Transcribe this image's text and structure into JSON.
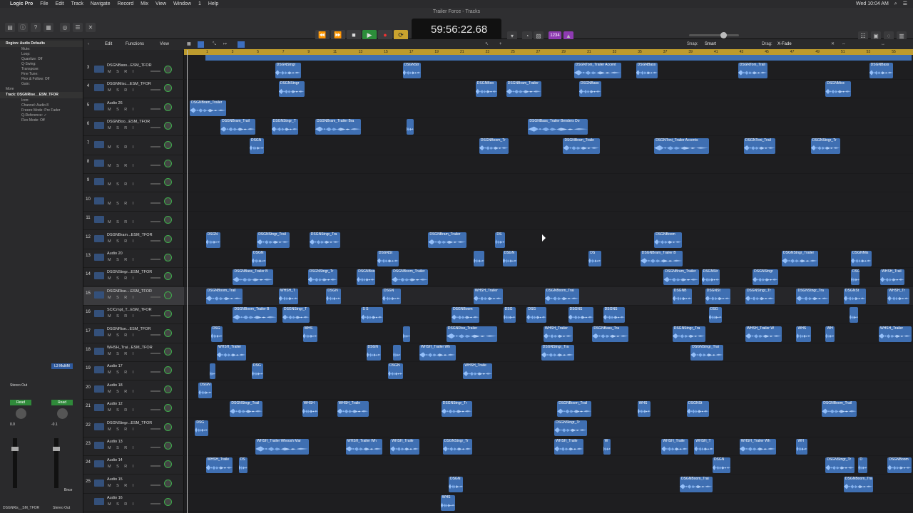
{
  "menubar": {
    "app": "Logic Pro",
    "items": [
      "File",
      "Edit",
      "Track",
      "Navigate",
      "Record",
      "Mix",
      "View",
      "Window",
      "1",
      "Help"
    ],
    "clock": "Wed 10:04 AM"
  },
  "window": {
    "title": "Trailer Force - Tracks"
  },
  "transport": {
    "time": "59:56:22.68",
    "rewind": "⏪",
    "forward": "⏩",
    "stop": "■",
    "play": "▶",
    "record": "●",
    "cycle": "⟳",
    "count_in": "1234"
  },
  "edit_bar": {
    "edit": "Edit",
    "functions": "Functions",
    "view": "View",
    "snap_label": "Snap:",
    "snap_value": "Smart",
    "drag_label": "Drag:",
    "drag_value": "X-Fade"
  },
  "inspector": {
    "region_header": "Region: Audio Defaults",
    "track_header": "Track: DSGNRise__ESM_TFOR",
    "params": [
      "Mute:",
      "Loop:",
      "Quantize: Off",
      "Q-Swing:",
      "Transpose:",
      "Fine Tune:",
      "Flex & Follow: Off",
      "Gain:"
    ],
    "track_params": [
      "Icon:",
      "Channel: Audio 8",
      "Freeze Mode: Pre Fader",
      "Q-Reference: ✓",
      "Flex Mode: Off"
    ],
    "more": "More",
    "stereo_out": "Stereo Out",
    "read1": "Read",
    "read2": "Read",
    "vol1": "0.0",
    "vol2": "-0.1",
    "multi": "L3 MultiM",
    "bottom_left": "DSGNRis__SM_TFOR",
    "bottom_right": "Stereo Out",
    "bnce": "Bnce"
  },
  "ruler": {
    "ticks": [
      "1",
      "3",
      "5",
      "7",
      "9",
      "11",
      "13",
      "15",
      "17",
      "19",
      "21",
      "23",
      "25",
      "27",
      "29",
      "31",
      "33",
      "35",
      "37",
      "39",
      "41",
      "43",
      "45",
      "47",
      "49",
      "51",
      "53",
      "55"
    ]
  },
  "tracks": [
    {
      "num": "3",
      "name": "DSGNBass...ESM_TFOR"
    },
    {
      "num": "4",
      "name": "DSGNMisc...ESM_TFOR"
    },
    {
      "num": "5",
      "name": "Audio 26"
    },
    {
      "num": "6",
      "name": "DSGNBoo...ESM_TFOR"
    },
    {
      "num": "7",
      "name": ""
    },
    {
      "num": "8",
      "name": ""
    },
    {
      "num": "9",
      "name": ""
    },
    {
      "num": "10",
      "name": ""
    },
    {
      "num": "11",
      "name": ""
    },
    {
      "num": "12",
      "name": "DSGNBram...ESM_TFOR"
    },
    {
      "num": "13",
      "name": "Audio 20"
    },
    {
      "num": "14",
      "name": "DSGNStngr...ESM_TFOR"
    },
    {
      "num": "15",
      "name": "DSGNRise....ESM_TFOR"
    },
    {
      "num": "16",
      "name": "SCICmpt_T...ESM_TFOR"
    },
    {
      "num": "17",
      "name": "DSGNRise...ESM_TFOR"
    },
    {
      "num": "18",
      "name": "WHSH_Trai...ESM_TFOR"
    },
    {
      "num": "19",
      "name": "Audio 17"
    },
    {
      "num": "20",
      "name": "Audio 18"
    },
    {
      "num": "21",
      "name": "Audio 12"
    },
    {
      "num": "22",
      "name": "DSGNStngr...ESM_TFOR"
    },
    {
      "num": "23",
      "name": "Audio 13"
    },
    {
      "num": "24",
      "name": "Audio 14"
    },
    {
      "num": "25",
      "name": "Audio 15"
    },
    {
      "num": "",
      "name": "Audio 16"
    }
  ],
  "ms_label": "M S R I",
  "regions": [
    {
      "lane": 0,
      "start": 0.125,
      "len": 0.035,
      "label": "DSGNStngr"
    },
    {
      "lane": 0,
      "start": 0.3,
      "len": 0.025,
      "label": "DSGNStr"
    },
    {
      "lane": 0,
      "start": 0.535,
      "len": 0.065,
      "label": "DSGNToni_Trailer Accent"
    },
    {
      "lane": 0,
      "start": 0.62,
      "len": 0.03,
      "label": "DSGNBass"
    },
    {
      "lane": 0,
      "start": 0.76,
      "len": 0.04,
      "label": "DSGNToni_Trail"
    },
    {
      "lane": 0,
      "start": 0.94,
      "len": 0.033,
      "label": "DSGNBass"
    },
    {
      "lane": 1,
      "start": 0.13,
      "len": 0.035,
      "label": "DSGNStngr"
    },
    {
      "lane": 1,
      "start": 0.4,
      "len": 0.03,
      "label": "DSGNBoo"
    },
    {
      "lane": 1,
      "start": 0.442,
      "len": 0.048,
      "label": "DSGNBram_Trailer"
    },
    {
      "lane": 1,
      "start": 0.542,
      "len": 0.03,
      "label": "DSGNBass"
    },
    {
      "lane": 1,
      "start": 0.88,
      "len": 0.035,
      "label": "DSGNMisc"
    },
    {
      "lane": 2,
      "start": 0.008,
      "len": 0.05,
      "label": "DSGNBram_Trailer"
    },
    {
      "lane": 3,
      "start": 0.05,
      "len": 0.048,
      "label": "DSGNBram_Trail"
    },
    {
      "lane": 3,
      "start": 0.12,
      "len": 0.037,
      "label": "DSGNStngr_T"
    },
    {
      "lane": 3,
      "start": 0.18,
      "len": 0.063,
      "label": "DSGNBram_Trailer Bra"
    },
    {
      "lane": 3,
      "start": 0.305,
      "len": 0.01,
      "label": ""
    },
    {
      "lane": 3,
      "start": 0.472,
      "len": 0.082,
      "label": "DSGNBass_Trailer Benders Do"
    },
    {
      "lane": 4,
      "start": 0.09,
      "len": 0.02,
      "label": "DSGN"
    },
    {
      "lane": 4,
      "start": 0.405,
      "len": 0.04,
      "label": "DSGNBoom_Tr"
    },
    {
      "lane": 4,
      "start": 0.52,
      "len": 0.05,
      "label": "DSGNBram_Traile"
    },
    {
      "lane": 4,
      "start": 0.645,
      "len": 0.075,
      "label": "DSGNToni_Trailer Accents"
    },
    {
      "lane": 4,
      "start": 0.768,
      "len": 0.043,
      "label": "DSGNToni_Trail"
    },
    {
      "lane": 4,
      "start": 0.86,
      "len": 0.04,
      "label": "DSGNStngr_Tr"
    },
    {
      "lane": 9,
      "start": 0.03,
      "len": 0.02,
      "label": "DSGN"
    },
    {
      "lane": 9,
      "start": 0.1,
      "len": 0.045,
      "label": "DSGNStngr_Trail"
    },
    {
      "lane": 9,
      "start": 0.172,
      "len": 0.042,
      "label": "DSGNStngr_Tra"
    },
    {
      "lane": 9,
      "start": 0.335,
      "len": 0.052,
      "label": "DSGNBram_Trailer"
    },
    {
      "lane": 9,
      "start": 0.427,
      "len": 0.013,
      "label": "DS"
    },
    {
      "lane": 9,
      "start": 0.645,
      "len": 0.038,
      "label": "DSGNBoom"
    },
    {
      "lane": 10,
      "start": 0.093,
      "len": 0.02,
      "label": "DSGN"
    },
    {
      "lane": 10,
      "start": 0.265,
      "len": 0.03,
      "label": "DSGNSt"
    },
    {
      "lane": 10,
      "start": 0.397,
      "len": 0.015,
      "label": ""
    },
    {
      "lane": 10,
      "start": 0.437,
      "len": 0.02,
      "label": "DSGN"
    },
    {
      "lane": 10,
      "start": 0.555,
      "len": 0.017,
      "label": "DS"
    },
    {
      "lane": 10,
      "start": 0.626,
      "len": 0.058,
      "label": "DSGNBram_Trailer B"
    },
    {
      "lane": 10,
      "start": 0.82,
      "len": 0.05,
      "label": "DSGNStngr_Trailer"
    },
    {
      "lane": 10,
      "start": 0.915,
      "len": 0.028,
      "label": "DSGNMis"
    },
    {
      "lane": 11,
      "start": 0.067,
      "len": 0.055,
      "label": "DSGNBass_Trailer B"
    },
    {
      "lane": 11,
      "start": 0.17,
      "len": 0.04,
      "label": "DSGNStngr_Tr"
    },
    {
      "lane": 11,
      "start": 0.237,
      "len": 0.025,
      "label": "DSGNBoo"
    },
    {
      "lane": 11,
      "start": 0.285,
      "len": 0.05,
      "label": "DSGNBoom_Trailer"
    },
    {
      "lane": 11,
      "start": 0.658,
      "len": 0.048,
      "label": "DSGNBram_Trailer"
    },
    {
      "lane": 11,
      "start": 0.71,
      "len": 0.025,
      "label": "DSGNStr"
    },
    {
      "lane": 11,
      "start": 0.78,
      "len": 0.035,
      "label": "DSGNStngr"
    },
    {
      "lane": 11,
      "start": 0.915,
      "len": 0.012,
      "label": "DSG"
    },
    {
      "lane": 11,
      "start": 0.955,
      "len": 0.033,
      "label": "WHSH_Trail"
    },
    {
      "lane": 12,
      "start": 0.03,
      "len": 0.05,
      "label": "DSGNBoom_Trail"
    },
    {
      "lane": 12,
      "start": 0.13,
      "len": 0.027,
      "label": "WHSH_T"
    },
    {
      "lane": 12,
      "start": 0.195,
      "len": 0.02,
      "label": "DSGN"
    },
    {
      "lane": 12,
      "start": 0.272,
      "len": 0.025,
      "label": "DSGN"
    },
    {
      "lane": 12,
      "start": 0.397,
      "len": 0.04,
      "label": "WHSH_Trailer"
    },
    {
      "lane": 12,
      "start": 0.495,
      "len": 0.047,
      "label": "DSGNBoom_Trai"
    },
    {
      "lane": 12,
      "start": 0.67,
      "len": 0.027,
      "label": "DSGNB"
    },
    {
      "lane": 12,
      "start": 0.715,
      "len": 0.035,
      "label": "DSGNSt"
    },
    {
      "lane": 12,
      "start": 0.77,
      "len": 0.04,
      "label": "DSGNStngr_Tr"
    },
    {
      "lane": 12,
      "start": 0.84,
      "len": 0.045,
      "label": "DSGNStngr_Tra"
    },
    {
      "lane": 12,
      "start": 0.905,
      "len": 0.03,
      "label": "DSGNSt"
    },
    {
      "lane": 12,
      "start": 0.965,
      "len": 0.03,
      "label": "WHSH_Tr"
    },
    {
      "lane": 13,
      "start": 0.067,
      "len": 0.06,
      "label": "DSGNBoom_Trailer B"
    },
    {
      "lane": 13,
      "start": 0.135,
      "len": 0.037,
      "label": "DSGNStngr_T"
    },
    {
      "lane": 13,
      "start": 0.243,
      "len": 0.03,
      "label": "S S"
    },
    {
      "lane": 13,
      "start": 0.367,
      "len": 0.038,
      "label": "DSGNBoom"
    },
    {
      "lane": 13,
      "start": 0.438,
      "len": 0.017,
      "label": "DSG"
    },
    {
      "lane": 13,
      "start": 0.47,
      "len": 0.027,
      "label": "DSG"
    },
    {
      "lane": 13,
      "start": 0.527,
      "len": 0.035,
      "label": "DSGNS"
    },
    {
      "lane": 13,
      "start": 0.575,
      "len": 0.03,
      "label": "DSGNS"
    },
    {
      "lane": 13,
      "start": 0.72,
      "len": 0.018,
      "label": "DSG"
    },
    {
      "lane": 13,
      "start": 0.913,
      "len": 0.012,
      "label": ""
    },
    {
      "lane": 14,
      "start": 0.037,
      "len": 0.016,
      "label": "DSG"
    },
    {
      "lane": 14,
      "start": 0.163,
      "len": 0.02,
      "label": "WHS"
    },
    {
      "lane": 14,
      "start": 0.3,
      "len": 0.01,
      "label": ""
    },
    {
      "lane": 14,
      "start": 0.36,
      "len": 0.07,
      "label": "DSGNRise_Trailer"
    },
    {
      "lane": 14,
      "start": 0.493,
      "len": 0.04,
      "label": "WHSH_Trailer"
    },
    {
      "lane": 14,
      "start": 0.56,
      "len": 0.05,
      "label": "DSGNBass_Tra"
    },
    {
      "lane": 14,
      "start": 0.67,
      "len": 0.045,
      "label": "DSGNStngr_Tra"
    },
    {
      "lane": 14,
      "start": 0.77,
      "len": 0.05,
      "label": "WHSH_Trailer W"
    },
    {
      "lane": 14,
      "start": 0.84,
      "len": 0.02,
      "label": "WHS"
    },
    {
      "lane": 14,
      "start": 0.88,
      "len": 0.012,
      "label": "WH"
    },
    {
      "lane": 14,
      "start": 0.953,
      "len": 0.045,
      "label": "WHSH_Trailer"
    },
    {
      "lane": 15,
      "start": 0.045,
      "len": 0.04,
      "label": "WHSH_Trailer"
    },
    {
      "lane": 15,
      "start": 0.25,
      "len": 0.02,
      "label": "DSGN"
    },
    {
      "lane": 15,
      "start": 0.287,
      "len": 0.01,
      "label": ""
    },
    {
      "lane": 15,
      "start": 0.323,
      "len": 0.05,
      "label": "WHSH_Trailer Wh"
    },
    {
      "lane": 15,
      "start": 0.49,
      "len": 0.045,
      "label": "DSGNStngr_Tra"
    },
    {
      "lane": 15,
      "start": 0.695,
      "len": 0.045,
      "label": "DSGNStngr_Trai"
    },
    {
      "lane": 16,
      "start": 0.035,
      "len": 0.008,
      "label": ""
    },
    {
      "lane": 16,
      "start": 0.093,
      "len": 0.016,
      "label": "DSG"
    },
    {
      "lane": 16,
      "start": 0.28,
      "len": 0.02,
      "label": "DSGN"
    },
    {
      "lane": 16,
      "start": 0.383,
      "len": 0.04,
      "label": "WHSH_Traile"
    },
    {
      "lane": 17,
      "start": 0.02,
      "len": 0.018,
      "label": "DSGN"
    },
    {
      "lane": 18,
      "start": 0.063,
      "len": 0.045,
      "label": "DSGNStngr_Trail"
    },
    {
      "lane": 18,
      "start": 0.162,
      "len": 0.022,
      "label": "WHSH"
    },
    {
      "lane": 18,
      "start": 0.21,
      "len": 0.043,
      "label": "WHSH_Traile"
    },
    {
      "lane": 18,
      "start": 0.353,
      "len": 0.042,
      "label": "DSGNStngr_Tr"
    },
    {
      "lane": 18,
      "start": 0.512,
      "len": 0.047,
      "label": "DSGNBoom_Trail"
    },
    {
      "lane": 18,
      "start": 0.622,
      "len": 0.018,
      "label": "WHS"
    },
    {
      "lane": 18,
      "start": 0.69,
      "len": 0.03,
      "label": "DSGNSt"
    },
    {
      "lane": 18,
      "start": 0.875,
      "len": 0.048,
      "label": "DSGNBoom_Trail"
    },
    {
      "lane": 19,
      "start": 0.015,
      "len": 0.018,
      "label": "DSG"
    },
    {
      "lane": 19,
      "start": 0.508,
      "len": 0.045,
      "label": "DSGNStngr_Tr"
    },
    {
      "lane": 20,
      "start": 0.098,
      "len": 0.073,
      "label": "WHSH_Trailer Whoosh Mar"
    },
    {
      "lane": 20,
      "start": 0.222,
      "len": 0.05,
      "label": "WHSH_Trailer Wh"
    },
    {
      "lane": 20,
      "start": 0.283,
      "len": 0.04,
      "label": "WHSH_Traile"
    },
    {
      "lane": 20,
      "start": 0.355,
      "len": 0.04,
      "label": "DSGNStngr_Tr"
    },
    {
      "lane": 20,
      "start": 0.508,
      "len": 0.04,
      "label": "WHSH_Traile"
    },
    {
      "lane": 20,
      "start": 0.575,
      "len": 0.01,
      "label": "W"
    },
    {
      "lane": 20,
      "start": 0.655,
      "len": 0.037,
      "label": "WHSH_Traile"
    },
    {
      "lane": 20,
      "start": 0.7,
      "len": 0.027,
      "label": "WHSH_T"
    },
    {
      "lane": 20,
      "start": 0.762,
      "len": 0.05,
      "label": "WHSH_Trailer Wh"
    },
    {
      "lane": 20,
      "start": 0.84,
      "len": 0.015,
      "label": "WH"
    },
    {
      "lane": 21,
      "start": 0.03,
      "len": 0.037,
      "label": "WHSH_Traile"
    },
    {
      "lane": 21,
      "start": 0.075,
      "len": 0.012,
      "label": "DS"
    },
    {
      "lane": 21,
      "start": 0.725,
      "len": 0.025,
      "label": "DSGN"
    },
    {
      "lane": 21,
      "start": 0.88,
      "len": 0.04,
      "label": "DSGNStngr_Tr"
    },
    {
      "lane": 21,
      "start": 0.925,
      "len": 0.012,
      "label": "D"
    },
    {
      "lane": 21,
      "start": 0.965,
      "len": 0.033,
      "label": "DSGNBoom"
    },
    {
      "lane": 22,
      "start": 0.363,
      "len": 0.02,
      "label": "DSGN"
    },
    {
      "lane": 22,
      "start": 0.68,
      "len": 0.045,
      "label": "DSGNBoom_Trai"
    },
    {
      "lane": 22,
      "start": 0.905,
      "len": 0.04,
      "label": "DSGNBoom_Tra"
    },
    {
      "lane": 23,
      "start": 0.352,
      "len": 0.02,
      "label": "WHS"
    }
  ]
}
